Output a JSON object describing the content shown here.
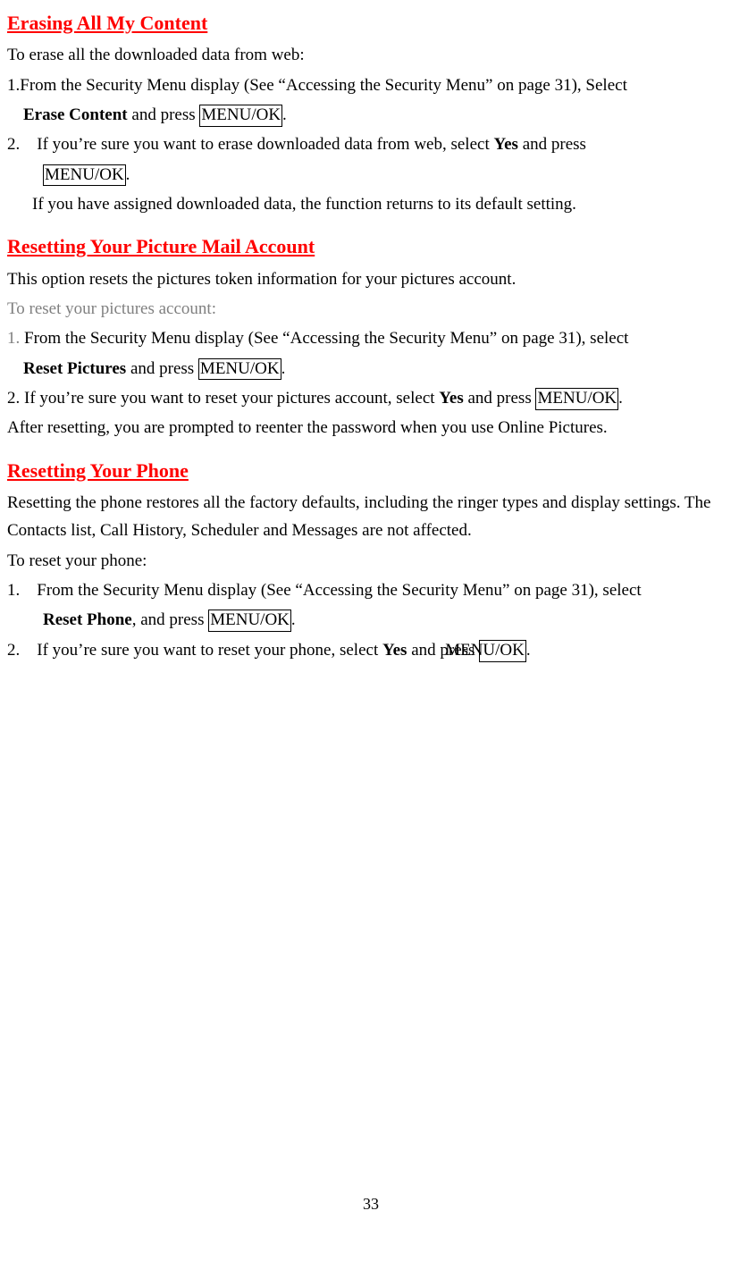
{
  "section1": {
    "heading": "Erasing All My Content",
    "intro": "To erase all the downloaded data from web:",
    "step1_a": "1.From the Security Menu display (See “Accessing the Security Menu” on page 31), Select",
    "step1_bold": "Erase Content",
    "step1_b": " and press ",
    "step1_box": "MENU/OK",
    "step1_c": ".",
    "step2_num": "2.",
    "step2_a": "If you’re sure you want to erase downloaded data from web, select ",
    "step2_bold": "Yes",
    "step2_b": " and press",
    "step2_box": "MENU/OK",
    "step2_c": ".",
    "bullet": "If you have assigned downloaded data, the function returns to its default setting."
  },
  "section2": {
    "heading": "Resetting Your Picture Mail Account",
    "intro": "This option resets the pictures token information for your pictures account.",
    "sub": "To reset your pictures account:",
    "step1_num": "1. ",
    "step1_a": "From the Security Menu display (See “Accessing the Security Menu” on page 31), select",
    "step1_bold": "Reset Pictures",
    "step1_b": " and press ",
    "step1_box": "MENU/OK",
    "step1_c": ".",
    "step2_num": "2. ",
    "step2_a": "If you’re sure you want to reset your pictures account, select ",
    "step2_bold": "Yes",
    "step2_b": " and press ",
    "step2_box": "MENU/OK",
    "step2_c": ".",
    "after": "After resetting, you are prompted to reenter the password when you use Online Pictures."
  },
  "section3": {
    "heading": "Resetting Your Phone",
    "intro": "Resetting the phone restores all the factory defaults, including the ringer types and display settings. The Contacts list, Call History, Scheduler and Messages are not affected.",
    "sub": "To reset your phone:",
    "step1_num": "1.",
    "step1_a": "From the Security Menu display (See “Accessing the Security Menu” on page 31), select",
    "step1_bold": "Reset Phone",
    "step1_b": ", and press ",
    "step1_box": "MENU/OK",
    "step1_c": ".",
    "step2_num": "2.",
    "step2_a": "If you’re sure you want to reset your phone, select ",
    "step2_bold": "Yes",
    "step2_b": " and press ",
    "step2_box": "MENU/OK",
    "step2_c": "."
  },
  "page_number": "33"
}
